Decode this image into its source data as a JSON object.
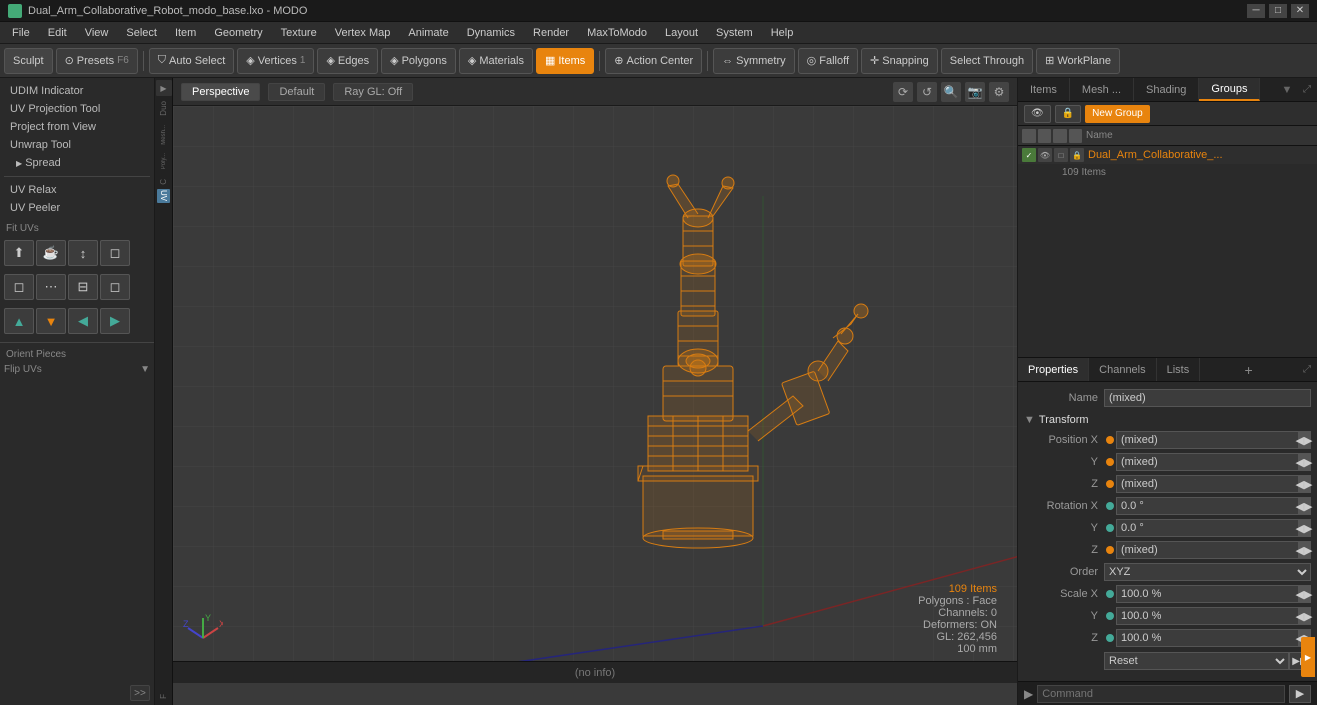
{
  "titlebar": {
    "title": "Dual_Arm_Collaborative_Robot_modo_base.lxo - MODO",
    "icon": "modo-icon",
    "controls": [
      "minimize",
      "maximize",
      "close"
    ]
  },
  "menubar": {
    "items": [
      "File",
      "Edit",
      "View",
      "Select",
      "Item",
      "Geometry",
      "Texture",
      "Vertex Map",
      "Animate",
      "Dynamics",
      "Render",
      "MaxToModo",
      "Layout",
      "System",
      "Help"
    ]
  },
  "toolbar": {
    "sculpt_label": "Sculpt",
    "presets_label": "Presets",
    "presets_shortcut": "F6",
    "auto_select_label": "Auto Select",
    "vertices_label": "Vertices",
    "vertices_count": "1",
    "edges_label": "Edges",
    "edges_count": "",
    "polygons_label": "Polygons",
    "polygons_count": "",
    "materials_label": "Materials",
    "items_label": "Items",
    "action_center_label": "Action Center",
    "symmetry_label": "Symmetry",
    "falloff_label": "Falloff",
    "snapping_label": "Snapping",
    "select_through_label": "Select Through",
    "workplane_label": "WorkPlane"
  },
  "left_panel": {
    "items": [
      "UDIM Indicator",
      "UV Projection Tool",
      "Project from View",
      "Unwrap Tool",
      "Spread",
      "",
      "UV Relax",
      "UV Peeler",
      "Fit UVs"
    ],
    "tools": [
      "▲",
      "☕",
      "↕",
      "◻",
      "◻",
      "◻",
      "◻",
      "◻",
      "◻",
      "◻",
      "◻",
      "◻",
      "↑",
      "↓",
      "←",
      "→"
    ],
    "orient_label": "Orient Pieces",
    "flip_label": "Flip UVs",
    "expand_label": ">>"
  },
  "side_strip": {
    "labels": [
      "Duo",
      "Mesh",
      "Poly",
      "C",
      "UV",
      "F"
    ]
  },
  "viewport": {
    "tabs": [
      "Perspective",
      "Default",
      "Ray GL: Off"
    ],
    "status": {
      "items": "109 Items",
      "polygons": "Polygons : Face",
      "channels": "Channels: 0",
      "deformers": "Deformers: ON",
      "gl": "GL: 262,456",
      "size": "100 mm"
    },
    "bottom_text": "(no info)",
    "axis": {
      "x": "X",
      "y": "Y",
      "z": "Z"
    }
  },
  "right_panel": {
    "tabs": [
      "Items",
      "Mesh ...",
      "Shading",
      "Groups"
    ],
    "active_tab": "Groups",
    "new_group_label": "New Group",
    "groups_header": {
      "name_col": "Name"
    },
    "groups": [
      {
        "name": "Dual_Arm_Collaborative_...",
        "count": "109 Items",
        "checked": true
      }
    ],
    "props": {
      "tabs": [
        "Properties",
        "Channels",
        "Lists",
        "+"
      ],
      "active_tab": "Properties",
      "name_label": "Name",
      "name_value": "(mixed)",
      "transform_section": "Transform",
      "position": {
        "x_label": "Position X",
        "x_value": "(mixed)",
        "y_label": "Y",
        "y_value": "(mixed)",
        "z_label": "Z",
        "z_value": "(mixed)"
      },
      "rotation": {
        "x_label": "Rotation X",
        "x_value": "0.0 °",
        "y_label": "Y",
        "y_value": "0.0 °",
        "z_label": "Z",
        "z_value": "(mixed)"
      },
      "order_label": "Order",
      "order_value": "XYZ",
      "scale": {
        "x_label": "Scale X",
        "x_value": "100.0 %",
        "y_label": "Y",
        "y_value": "100.0 %",
        "z_label": "Z",
        "z_value": "100.0 %"
      },
      "reset_label": "Reset"
    }
  },
  "command_bar": {
    "arrow": "▶",
    "placeholder": "Command",
    "run_btn": "▶"
  }
}
